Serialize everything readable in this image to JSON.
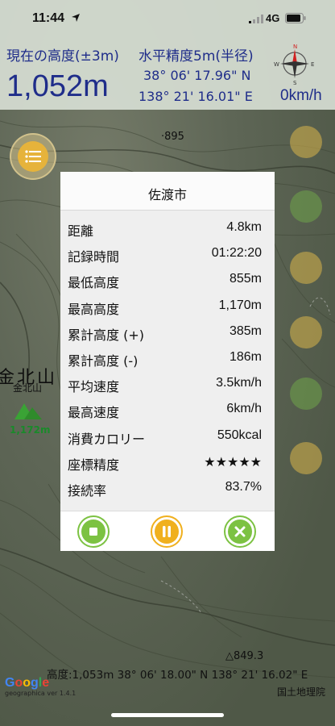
{
  "status_bar": {
    "time": "11:44",
    "network": "4G"
  },
  "header": {
    "altitude_label": "現在の高度(±3m)",
    "altitude_value": "1,052m",
    "accuracy_label": "水平精度5m(半径)",
    "latitude": "38° 06' 17.96\" N",
    "longitude": "138° 21' 16.01\" E",
    "speed": "0km/h",
    "compass": {
      "n": "N",
      "e": "E",
      "s": "S",
      "w": "W"
    }
  },
  "map": {
    "peak_895": "·895",
    "mountain_name_big": "金北山",
    "mountain_name_small": "金北山",
    "mountain_elev": "1,172m",
    "peak_849": "△849.3",
    "coord_footer": "高度:1,053m  38° 06' 18.00\" N 138° 21' 16.02\" E",
    "gsi_credit": "国土地理院",
    "google_logo": [
      "G",
      "o",
      "o",
      "g",
      "l",
      "e"
    ],
    "version": "geographica ver 1.4.1"
  },
  "modal": {
    "title": "佐渡市",
    "stats": [
      {
        "label": "距離",
        "value": "4.8km"
      },
      {
        "label": "記録時間",
        "value": "01:22:20"
      },
      {
        "label": "最低高度",
        "value": "855m"
      },
      {
        "label": "最高高度",
        "value": "1,170m"
      },
      {
        "label": "累計高度 (+)",
        "value": "385m"
      },
      {
        "label": "累計高度 (-)",
        "value": "186m"
      },
      {
        "label": "平均速度",
        "value": "3.5km/h"
      },
      {
        "label": "最高速度",
        "value": "6km/h"
      },
      {
        "label": "消費カロリー",
        "value": "550kcal"
      },
      {
        "label": "座標精度",
        "value": "★★★★★"
      },
      {
        "label": "接続率",
        "value": "83.7%"
      }
    ]
  },
  "colors": {
    "header_text": "#1f2d8a",
    "stop_button": "#7cc242",
    "pause_button": "#f0b01e",
    "close_button": "#7cc242",
    "menu_button": "#e6b33b"
  }
}
